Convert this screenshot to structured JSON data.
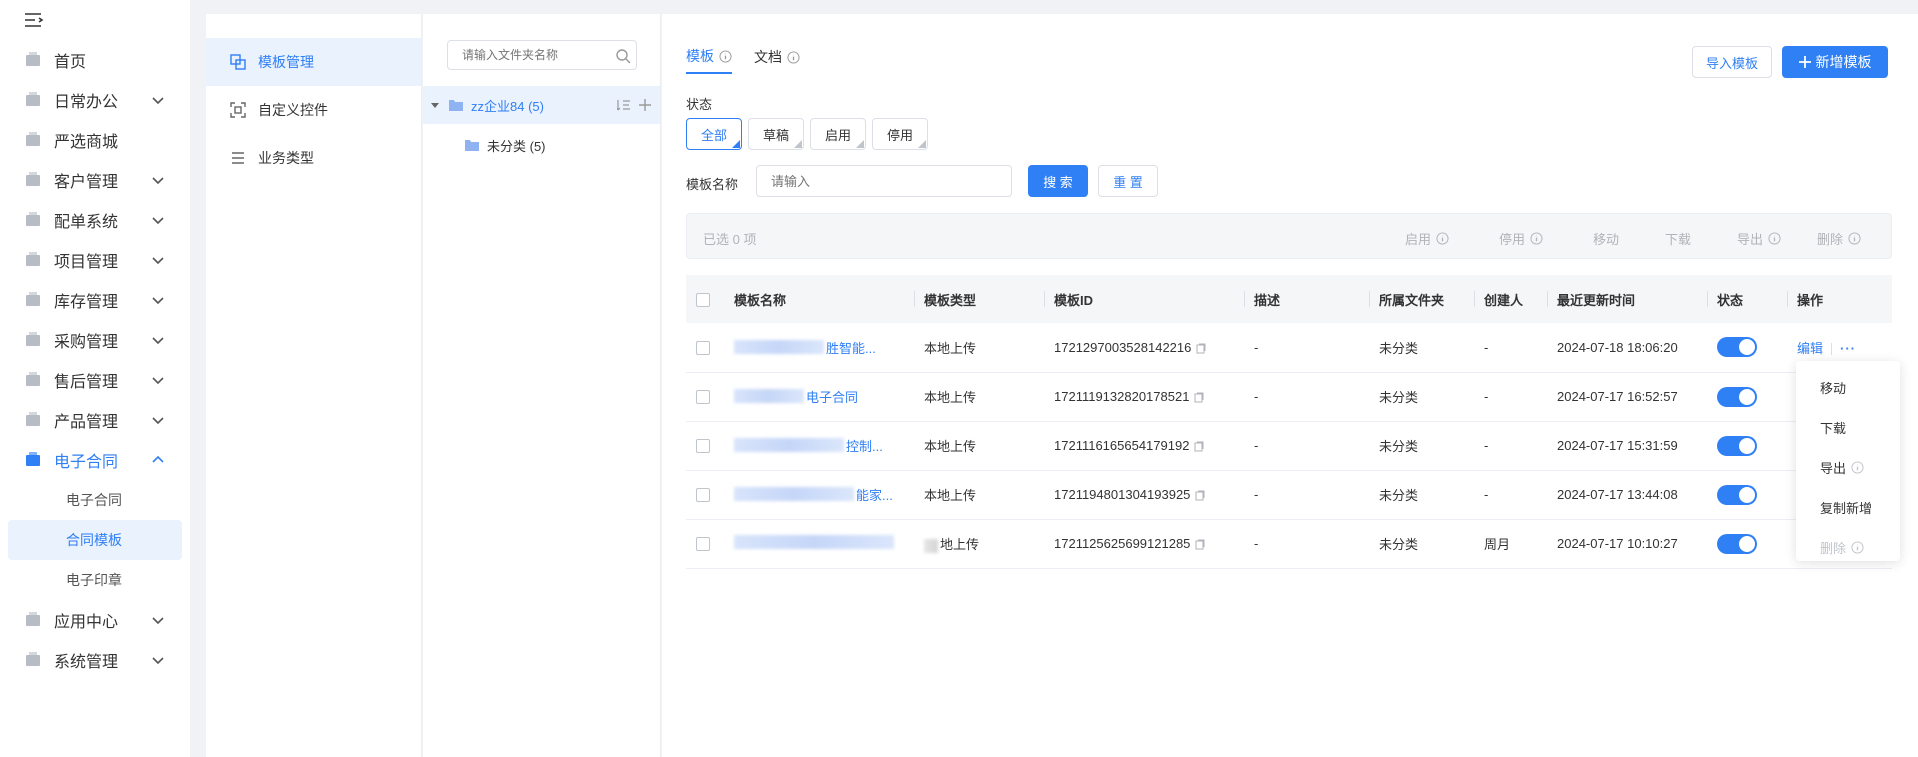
{
  "nav": {
    "items": [
      {
        "label": "首页",
        "icon": "home-icon"
      },
      {
        "label": "日常办公",
        "icon": "briefcase-icon"
      },
      {
        "label": "严选商城",
        "icon": "mall-icon"
      },
      {
        "label": "客户管理",
        "icon": "customer-icon"
      },
      {
        "label": "配单系统",
        "icon": "order-icon"
      },
      {
        "label": "项目管理",
        "icon": "folder-icon"
      },
      {
        "label": "库存管理",
        "icon": "inventory-icon"
      },
      {
        "label": "采购管理",
        "icon": "cart-icon"
      },
      {
        "label": "售后管理",
        "icon": "headset-icon"
      },
      {
        "label": "产品管理",
        "icon": "box-icon"
      },
      {
        "label": "电子合同",
        "icon": "contract-icon"
      },
      {
        "label": "应用中心",
        "icon": "apps-icon"
      },
      {
        "label": "系统管理",
        "icon": "settings-icon"
      }
    ],
    "contract_sub": [
      "电子合同",
      "合同模板",
      "电子印章"
    ]
  },
  "panel2": {
    "items": [
      "模板管理",
      "自定义控件",
      "业务类型"
    ]
  },
  "tree": {
    "search_placeholder": "请输入文件夹名称",
    "root": "zz企业84 (5)",
    "child": "未分类 (5)"
  },
  "main": {
    "tabs": [
      "模板",
      "文档"
    ],
    "import_label": "导入模板",
    "add_label": "新增模板",
    "status_label": "状态",
    "status_options": [
      "全部",
      "草稿",
      "启用",
      "停用"
    ],
    "name_label": "模板名称",
    "name_placeholder": "请输入",
    "search_label": "搜 索",
    "reset_label": "重 置",
    "batch": {
      "selected": "已选  0  项",
      "actions": [
        "启用",
        "停用",
        "移动",
        "下载",
        "导出",
        "删除"
      ]
    },
    "columns": [
      "模板名称",
      "模板类型",
      "模板ID",
      "描述",
      "所属文件夹",
      "创建人",
      "最近更新时间",
      "状态",
      "操作"
    ],
    "rows": [
      {
        "name": "胜智能...",
        "type": "本地上传",
        "id": "1721297003528142216",
        "desc": "-",
        "folder": "未分类",
        "creator": "-",
        "updated": "2024-07-18 18:06:20"
      },
      {
        "name": "电子合同",
        "type": "本地上传",
        "id": "1721119132820178521",
        "desc": "-",
        "folder": "未分类",
        "creator": "-",
        "updated": "2024-07-17 16:52:57"
      },
      {
        "name": "控制...",
        "type": "本地上传",
        "id": "1721116165654179192",
        "desc": "-",
        "folder": "未分类",
        "creator": "-",
        "updated": "2024-07-17 15:31:59"
      },
      {
        "name": "能家...",
        "type": "本地上传",
        "id": "1721194801304193925",
        "desc": "-",
        "folder": "未分类",
        "creator": "-",
        "updated": "2024-07-17 13:44:08"
      },
      {
        "name": "",
        "type": "地上传",
        "id": "1721125625699121285",
        "desc": "-",
        "folder": "未分类",
        "creator": "周月",
        "updated": "2024-07-17 10:10:27"
      }
    ],
    "row_actions": {
      "edit": "编辑",
      "more": "···"
    },
    "dropdown": [
      "移动",
      "下载",
      "导出",
      "复制新增",
      "删除"
    ]
  },
  "colors": {
    "accent": "#2f7ff5",
    "active_bg": "#eaf2fe"
  }
}
